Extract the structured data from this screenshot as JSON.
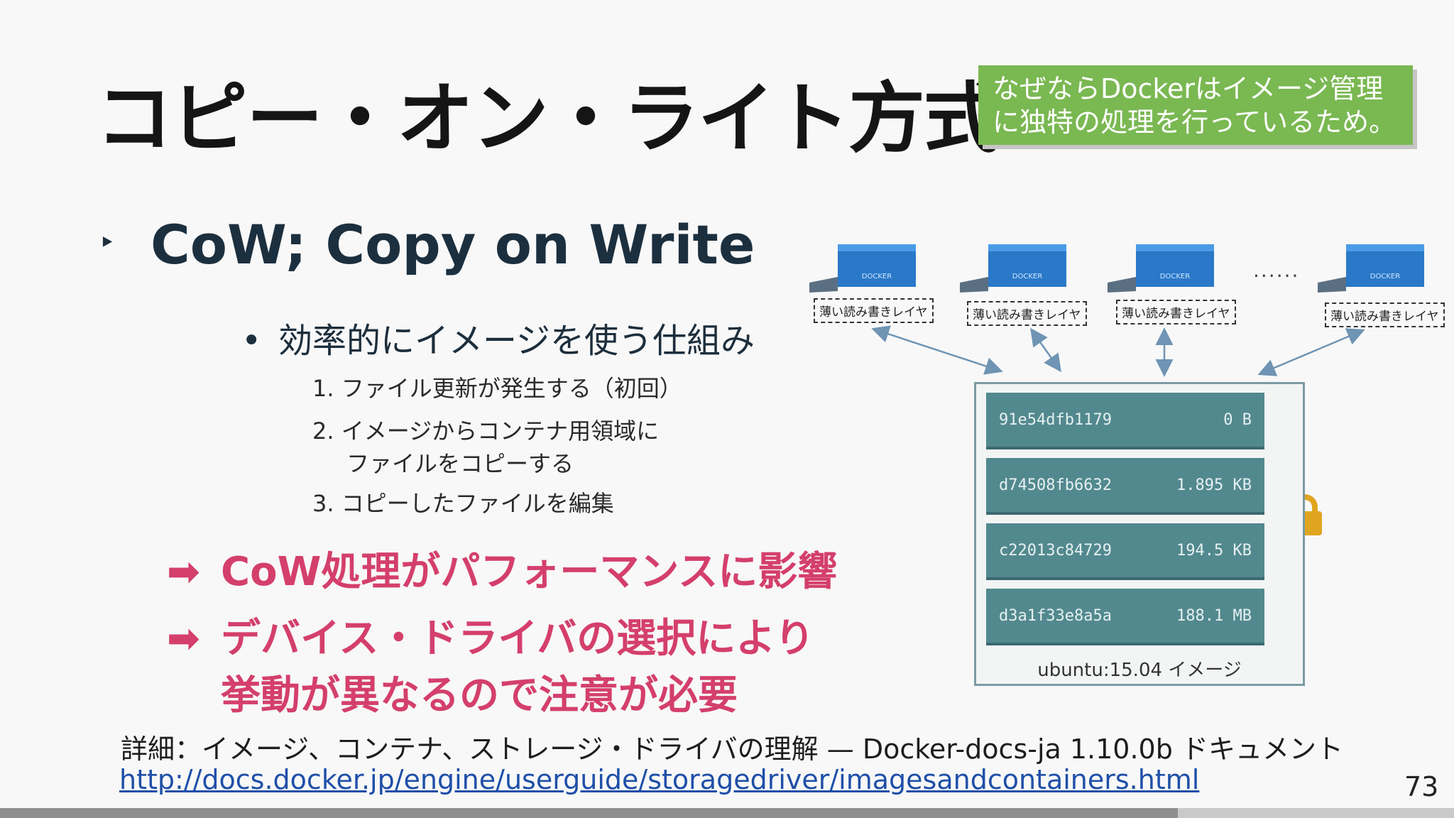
{
  "slide": {
    "title": "コピー・オン・ライト方式",
    "note_lines": [
      "なぜならDockerはイメージ管理",
      "に独特の処理を行っているため。"
    ],
    "bullet_l1": "CoW; Copy on Write",
    "bullet_l1_marker": "‣",
    "bullet_l2": "効率的にイメージを使う仕組み",
    "bullet_l2_marker": "•",
    "steps": {
      "s1": "1. ファイル更新が発生する（初回）",
      "s2a": "2. イメージからコンテナ用領域に",
      "s2b": "ファイルをコピーする",
      "s3": "3. コピーしたファイルを編集"
    },
    "arrow_marker": "➡",
    "point1": "CoW処理がパフォーマンスに影響",
    "point2a": "デバイス・ドライバの選択により",
    "point2b": "挙動が異なるので注意が必要",
    "detail": "詳細：イメージ、コンテナ、ストレージ・ドライバの理解 — Docker-docs-ja 1.10.0b ドキュメント",
    "link": "http://docs.docker.jp/engine/userguide/storagedriver/imagesandcontainers.html",
    "page_number": "73",
    "progress_fraction": 0.81
  },
  "diagram": {
    "container_label": "薄い読み書きレイヤ",
    "dots": "......",
    "container_logo": "DOCKER",
    "layers": [
      {
        "id": "91e54dfb1179",
        "size": "0 B"
      },
      {
        "id": "d74508fb6632",
        "size": "1.895 KB"
      },
      {
        "id": "c22013c84729",
        "size": "194.5 KB"
      },
      {
        "id": "d3a1f33e8a5a",
        "size": "188.1 MB"
      }
    ],
    "image_caption": "ubuntu:15.04 イメージ"
  },
  "colors": {
    "note_bg": "#7ab852",
    "accent_pink": "#d43f6c",
    "layer_teal": "#52898f",
    "container_blue": "#2a78c8",
    "lock_gold": "#e0a520"
  }
}
